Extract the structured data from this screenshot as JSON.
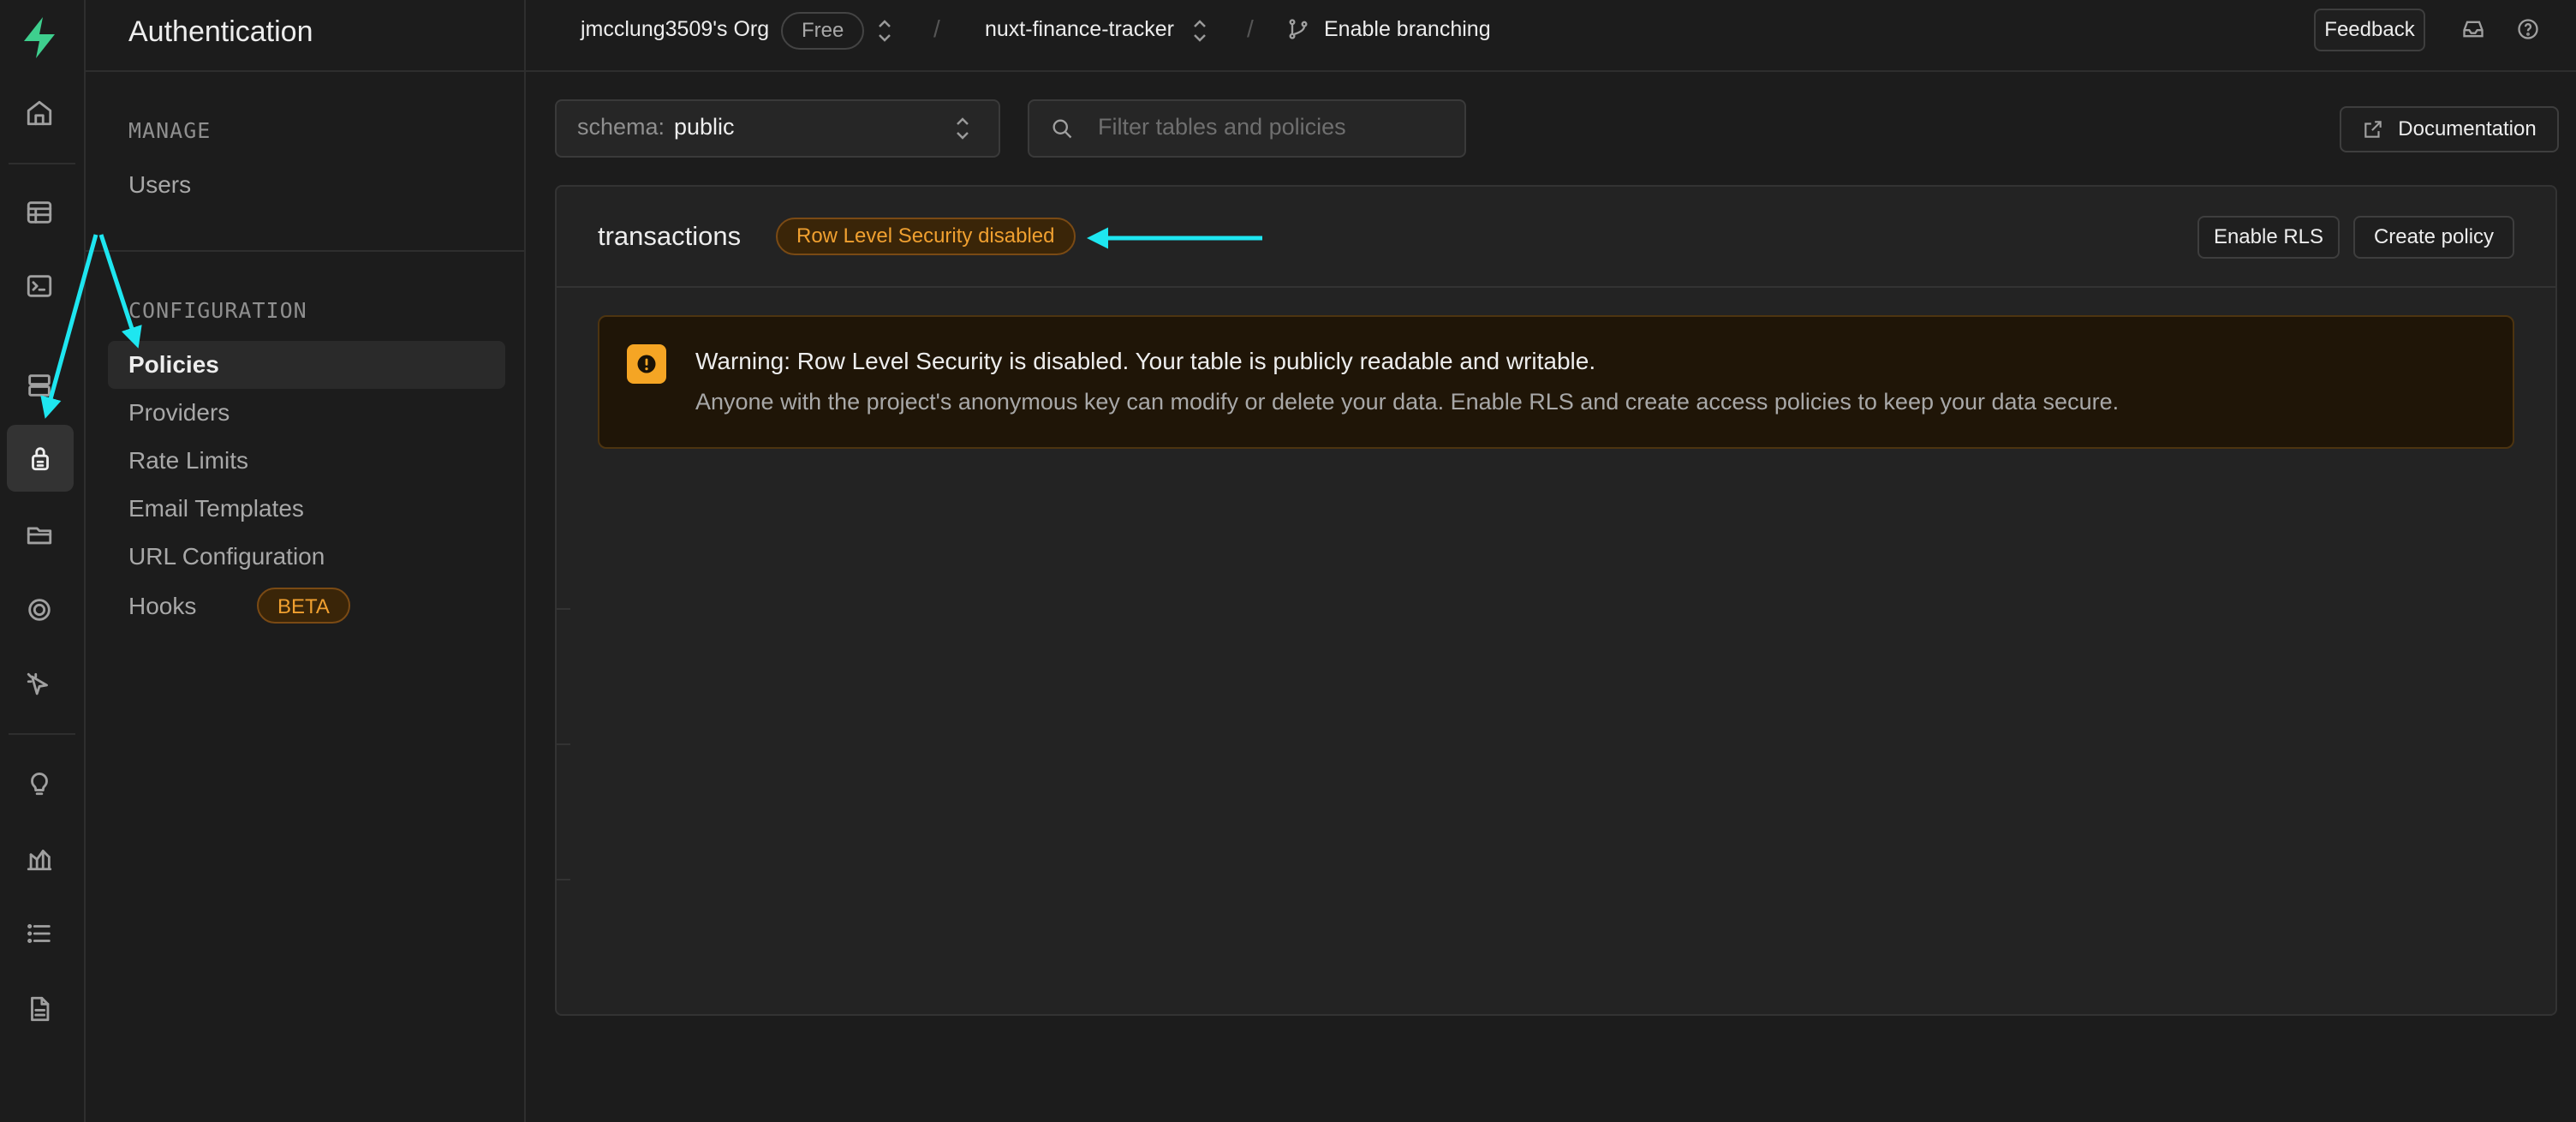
{
  "icons": {
    "logo": "supabase-bolt-icon",
    "rail": [
      "home-icon",
      "table-editor-icon",
      "sql-editor-icon",
      "database-icon",
      "authentication-icon",
      "storage-icon",
      "realtime-icon",
      "edge-functions-icon",
      "advisors-icon",
      "reports-icon",
      "logs-icon",
      "api-docs-icon"
    ]
  },
  "colors": {
    "accent": "#3ecf8e",
    "warning": "#f5a524",
    "annotation_arrow": "#1ee6f0"
  },
  "sidebar": {
    "title": "Authentication",
    "sections": [
      {
        "label": "MANAGE",
        "items": [
          {
            "label": "Users"
          }
        ]
      },
      {
        "label": "CONFIGURATION",
        "items": [
          {
            "label": "Policies",
            "active": true
          },
          {
            "label": "Providers"
          },
          {
            "label": "Rate Limits"
          },
          {
            "label": "Email Templates"
          },
          {
            "label": "URL Configuration"
          },
          {
            "label": "Hooks",
            "badge": "BETA"
          }
        ]
      }
    ]
  },
  "header": {
    "org": "jmcclung3509's Org",
    "plan": "Free",
    "project": "nuxt-finance-tracker",
    "branching": "Enable branching",
    "feedback": "Feedback"
  },
  "toolbar": {
    "schema_prefix": "schema:",
    "schema_value": "public",
    "search_placeholder": "Filter tables and policies",
    "documentation": "Documentation"
  },
  "table": {
    "name": "transactions",
    "rls_badge": "Row Level Security disabled",
    "enable_rls": "Enable RLS",
    "create_policy": "Create policy",
    "warning_title": "Warning: Row Level Security is disabled. Your table is publicly readable and writable.",
    "warning_body": "Anyone with the project's anonymous key can modify or delete your data. Enable RLS and create access policies to keep your data secure."
  }
}
